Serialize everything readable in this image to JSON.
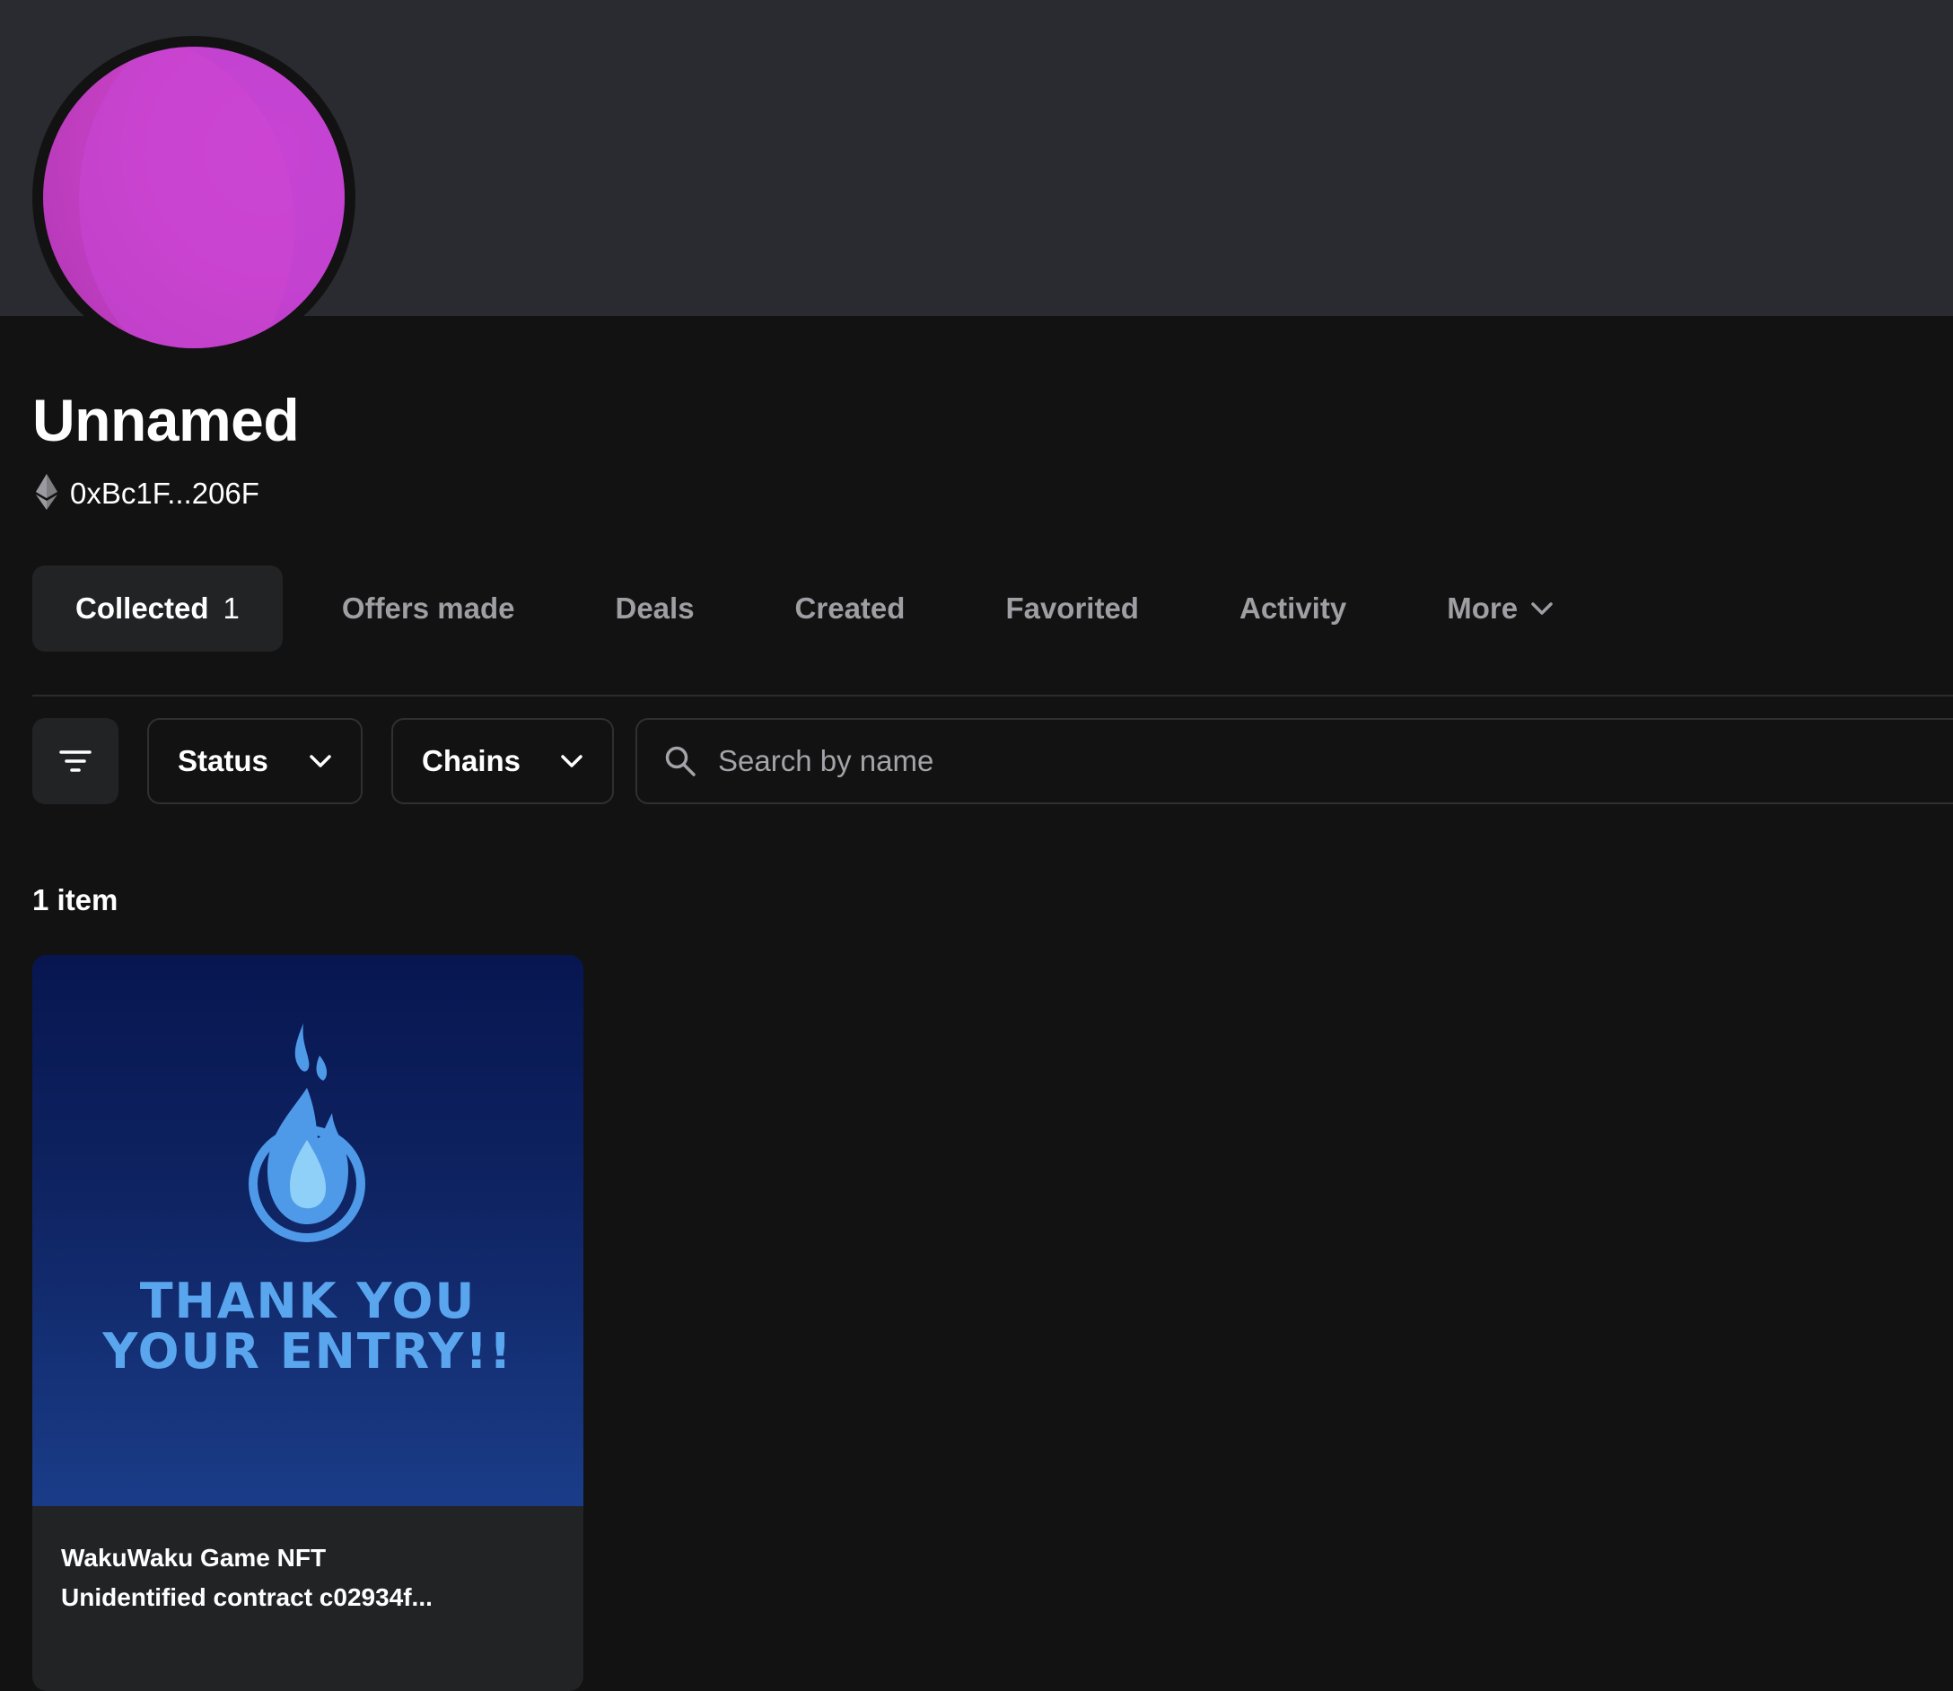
{
  "profile": {
    "name": "Unnamed",
    "address": "0xBc1F...206F"
  },
  "tabs": [
    {
      "label": "Collected",
      "count": "1",
      "active": true
    },
    {
      "label": "Offers made"
    },
    {
      "label": "Deals"
    },
    {
      "label": "Created"
    },
    {
      "label": "Favorited"
    },
    {
      "label": "Activity"
    },
    {
      "label": "More"
    }
  ],
  "filters": {
    "status_label": "Status",
    "chains_label": "Chains",
    "search_placeholder": "Search by name"
  },
  "results": {
    "count_label": "1 item"
  },
  "items": [
    {
      "image_text_line1": "THANK YOU",
      "image_text_line2": "YOUR ENTRY!!",
      "collection": "WakuWaku Game NFT",
      "name": "Unidentified contract c02934f..."
    }
  ],
  "colors": {
    "background": "#121212",
    "banner": "#2a2b30",
    "avatar": "#bd3ec6",
    "muted_text": "#9e9ea3",
    "nft_text": "#5aa6ee"
  }
}
